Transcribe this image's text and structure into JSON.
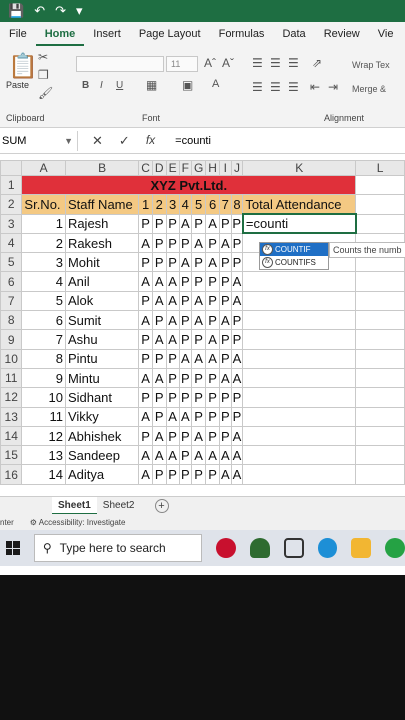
{
  "menu": {
    "tabs": [
      "File",
      "Home",
      "Insert",
      "Page Layout",
      "Formulas",
      "Data",
      "Review",
      "Vie"
    ],
    "active": "Home"
  },
  "ribbon": {
    "paste_label": "Paste",
    "clipboard_label": "Clipboard",
    "font_label": "Font",
    "font_size": "11",
    "alignment_label": "Alignment",
    "wrap_text": "Wrap Tex",
    "merge": "Merge &"
  },
  "formula_bar": {
    "name_box": "SUM",
    "formula": "=counti"
  },
  "columns": [
    "A",
    "B",
    "C",
    "D",
    "E",
    "F",
    "G",
    "H",
    "I",
    "J",
    "K",
    "L"
  ],
  "title_row": {
    "row": "1",
    "text": "XYZ Pvt.Ltd."
  },
  "header_row": {
    "row": "2",
    "sr_no": "Sr.No.",
    "staff_name": "Staff Name",
    "days": [
      "1",
      "2",
      "3",
      "4",
      "5",
      "6",
      "7",
      "8"
    ],
    "total": "Total Attendance"
  },
  "staff": [
    {
      "row": "3",
      "sr": "1",
      "name": "Rajesh",
      "att": [
        "P",
        "P",
        "P",
        "A",
        "P",
        "A",
        "P",
        "P"
      ]
    },
    {
      "row": "4",
      "sr": "2",
      "name": "Rakesh",
      "att": [
        "A",
        "P",
        "P",
        "P",
        "A",
        "P",
        "A",
        "P"
      ]
    },
    {
      "row": "5",
      "sr": "3",
      "name": "Mohit",
      "att": [
        "P",
        "P",
        "P",
        "A",
        "P",
        "A",
        "P",
        "P"
      ]
    },
    {
      "row": "6",
      "sr": "4",
      "name": "Anil",
      "att": [
        "A",
        "A",
        "A",
        "P",
        "P",
        "P",
        "P",
        "A"
      ]
    },
    {
      "row": "7",
      "sr": "5",
      "name": "Alok",
      "att": [
        "P",
        "A",
        "A",
        "P",
        "A",
        "P",
        "P",
        "A"
      ]
    },
    {
      "row": "8",
      "sr": "6",
      "name": "Sumit",
      "att": [
        "A",
        "P",
        "A",
        "P",
        "A",
        "P",
        "A",
        "P"
      ]
    },
    {
      "row": "9",
      "sr": "7",
      "name": "Ashu",
      "att": [
        "P",
        "A",
        "A",
        "P",
        "P",
        "A",
        "P",
        "P"
      ]
    },
    {
      "row": "10",
      "sr": "8",
      "name": "Pintu",
      "att": [
        "P",
        "P",
        "P",
        "A",
        "A",
        "A",
        "P",
        "A"
      ]
    },
    {
      "row": "11",
      "sr": "9",
      "name": "Mintu",
      "att": [
        "A",
        "A",
        "P",
        "P",
        "P",
        "P",
        "A",
        "A"
      ]
    },
    {
      "row": "12",
      "sr": "10",
      "name": "Sidhant",
      "att": [
        "P",
        "P",
        "P",
        "P",
        "P",
        "P",
        "P",
        "P"
      ]
    },
    {
      "row": "13",
      "sr": "11",
      "name": "Vikky",
      "att": [
        "A",
        "P",
        "A",
        "A",
        "P",
        "P",
        "P",
        "P"
      ]
    },
    {
      "row": "14",
      "sr": "12",
      "name": "Abhishek",
      "att": [
        "P",
        "A",
        "P",
        "P",
        "A",
        "P",
        "P",
        "A"
      ]
    },
    {
      "row": "15",
      "sr": "13",
      "name": "Sandeep",
      "att": [
        "A",
        "A",
        "A",
        "P",
        "A",
        "A",
        "A",
        "A"
      ]
    },
    {
      "row": "16",
      "sr": "14",
      "name": "Aditya",
      "att": [
        "A",
        "P",
        "P",
        "P",
        "P",
        "P",
        "A",
        "A"
      ]
    }
  ],
  "active_cell_text": "=counti",
  "autocomplete": {
    "items": [
      "COUNTIF",
      "COUNTIFS"
    ],
    "selected": "COUNTIF",
    "tooltip": "Counts the numb"
  },
  "sheets": {
    "tabs": [
      "Sheet1",
      "Sheet2"
    ],
    "active": "Sheet1"
  },
  "status": {
    "mode": "nter",
    "accessibility": "Accessibility: Investigate"
  },
  "taskbar": {
    "search_placeholder": "Type here to search"
  },
  "colors": {
    "excel_green": "#1e6e42",
    "title_red": "#e0303a",
    "header_orange": "#f4c983",
    "selection_blue": "#1f6fc5"
  }
}
